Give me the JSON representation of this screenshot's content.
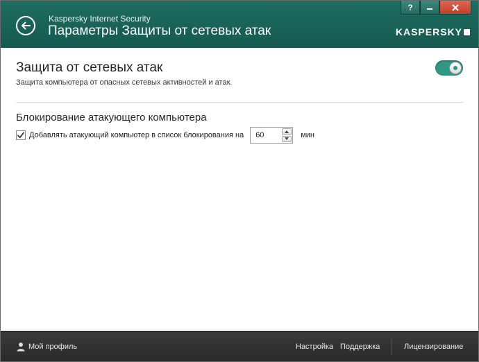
{
  "window": {
    "app_name": "Kaspersky Internet Security",
    "title": "Параметры Защиты от сетевых атак",
    "logo_text": "KASPERSKY",
    "help_label": "?",
    "accent_color": "#1e6d61"
  },
  "section": {
    "title": "Защита от сетевых атак",
    "description": "Защита компьютера от опасных сетевых активностей и атак.",
    "enabled": true
  },
  "blocking": {
    "title": "Блокирование атакующего компьютера",
    "option_label": "Добавлять атакующий компьютер в список блокирования на",
    "checked": true,
    "minutes_value": "60",
    "unit_label": "мин"
  },
  "footer": {
    "profile_label": "Мой профиль",
    "settings_label": "Настройка",
    "support_label": "Поддержка",
    "licensing_label": "Лицензирование"
  }
}
